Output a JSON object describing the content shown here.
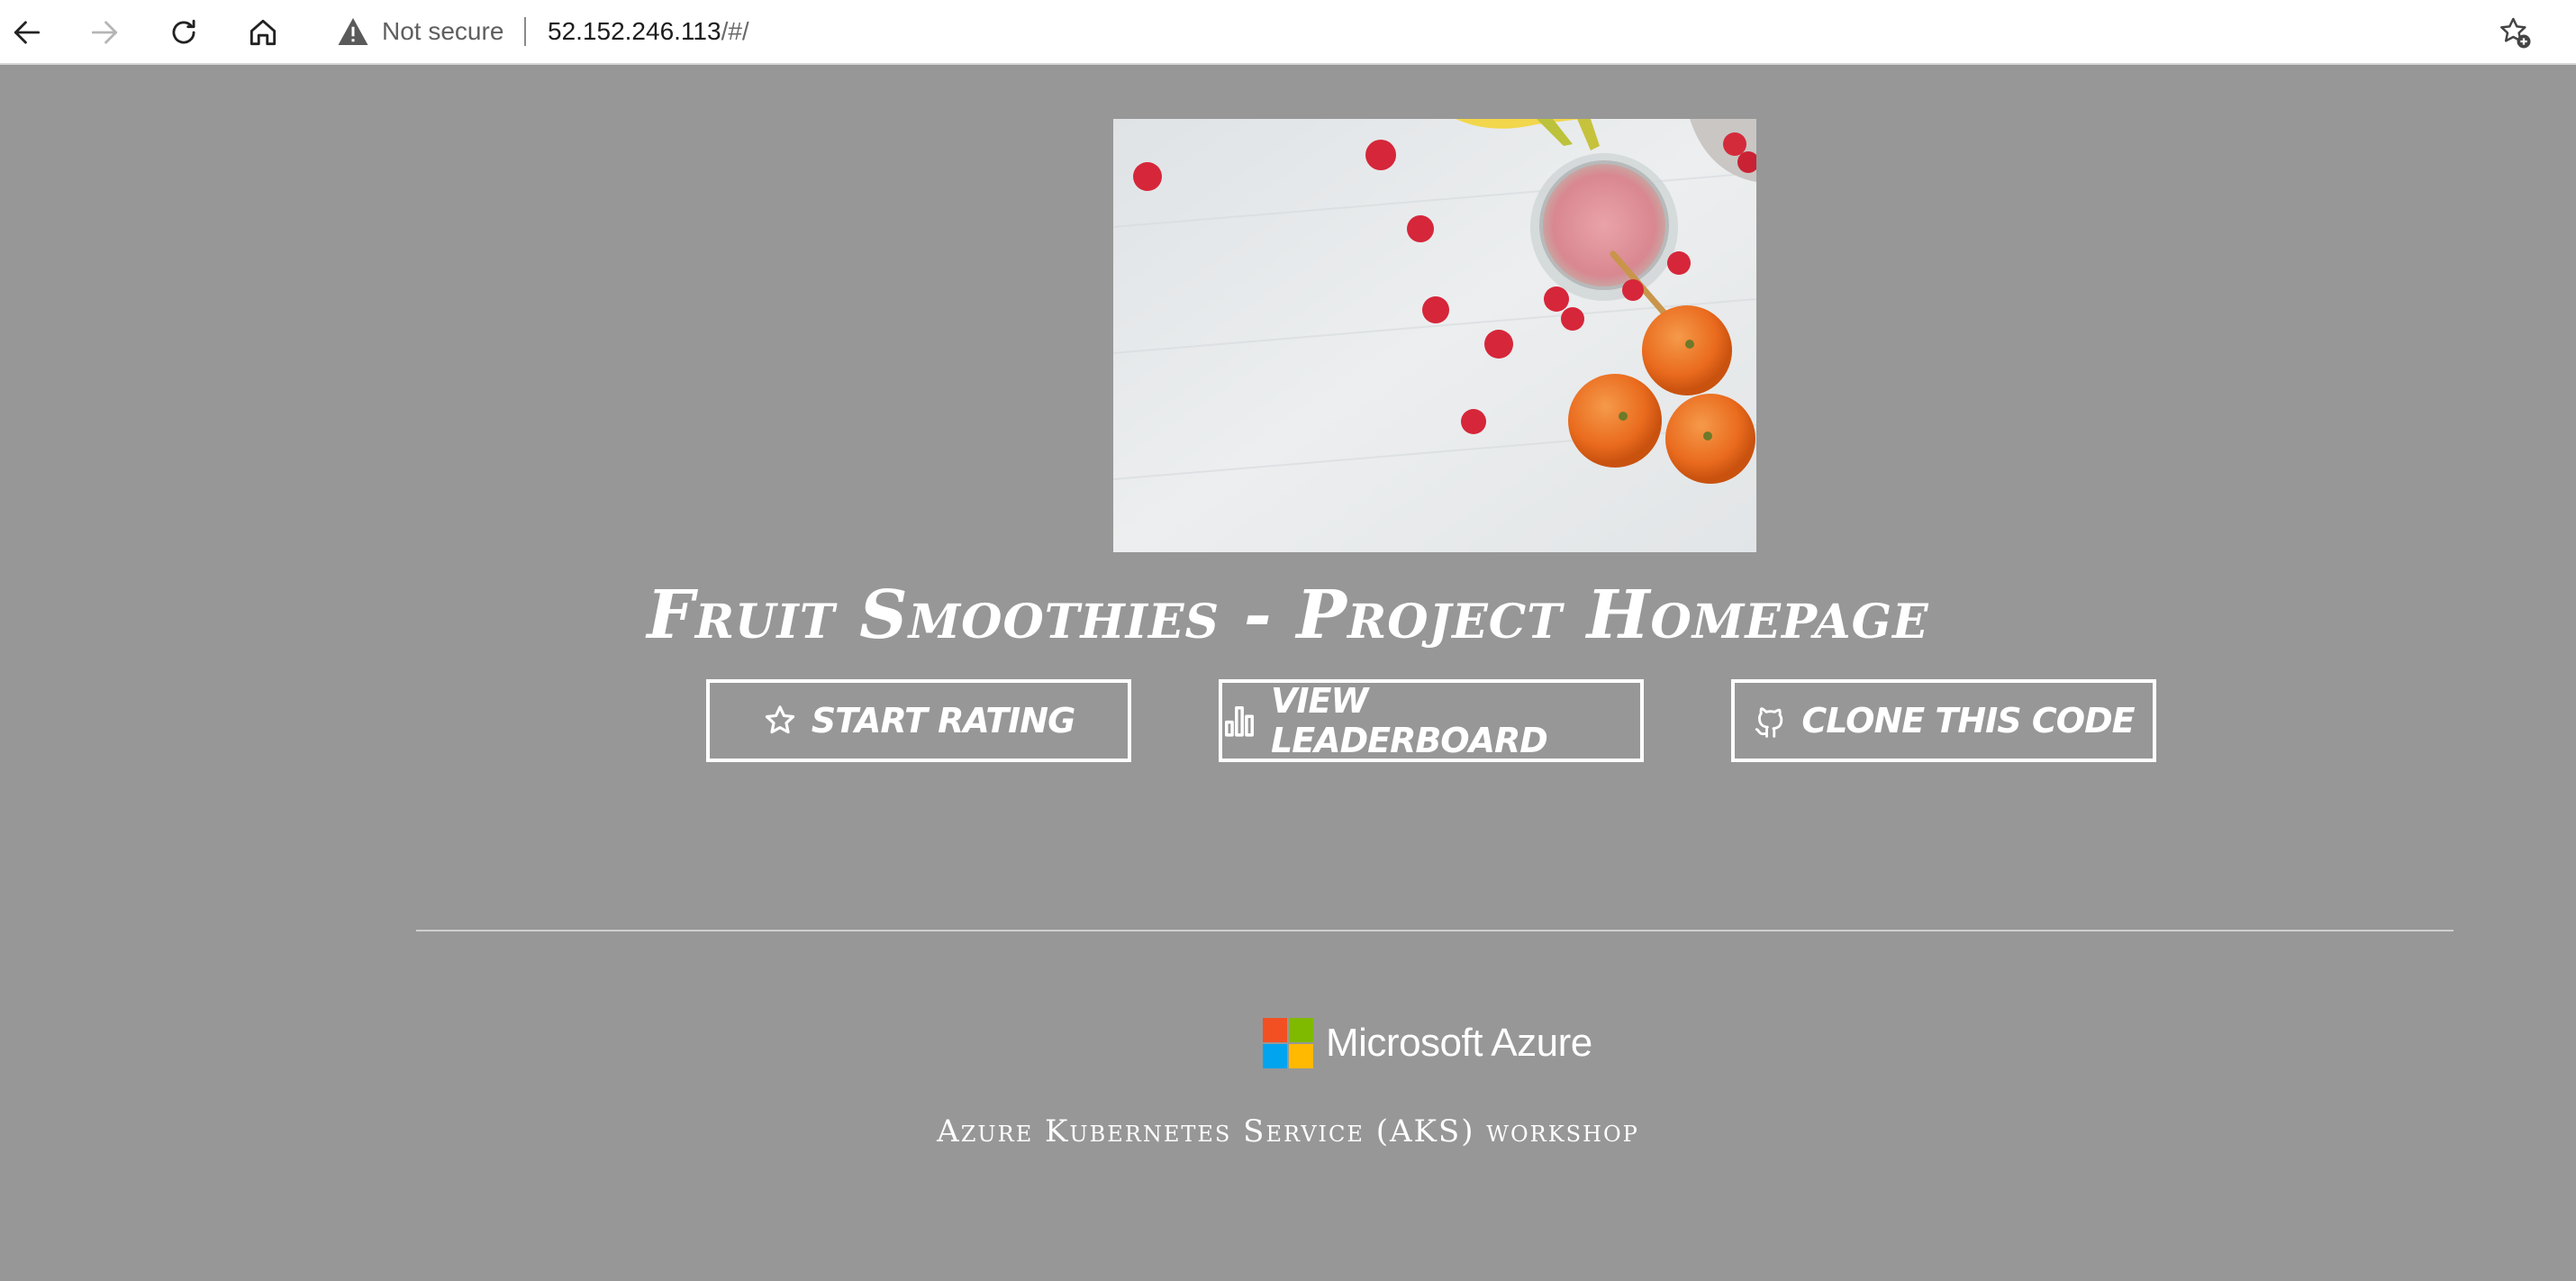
{
  "browser": {
    "security_label": "Not secure",
    "url_host": "52.152.246.113",
    "url_hash": "/#/",
    "icons": [
      "back-icon",
      "forward-icon",
      "reload-icon",
      "home-icon",
      "warning-icon",
      "favorites-icon"
    ]
  },
  "page": {
    "title": "Fruit Smoothies - Project Homepage",
    "buttons": [
      {
        "label": "Start Rating",
        "icon": "star-icon"
      },
      {
        "label": "View Leaderboard",
        "icon": "bar-chart-icon"
      },
      {
        "label": "Clone this code",
        "icon": "github-icon"
      }
    ],
    "azure_logo_text": "Microsoft Azure",
    "footer": "Azure Kubernetes Service (AKS) workshop"
  },
  "colors": {
    "page_background": "#979797",
    "ms_red": "#f25022",
    "ms_green": "#7fba00",
    "ms_blue": "#00a4ef",
    "ms_yellow": "#ffb900"
  }
}
